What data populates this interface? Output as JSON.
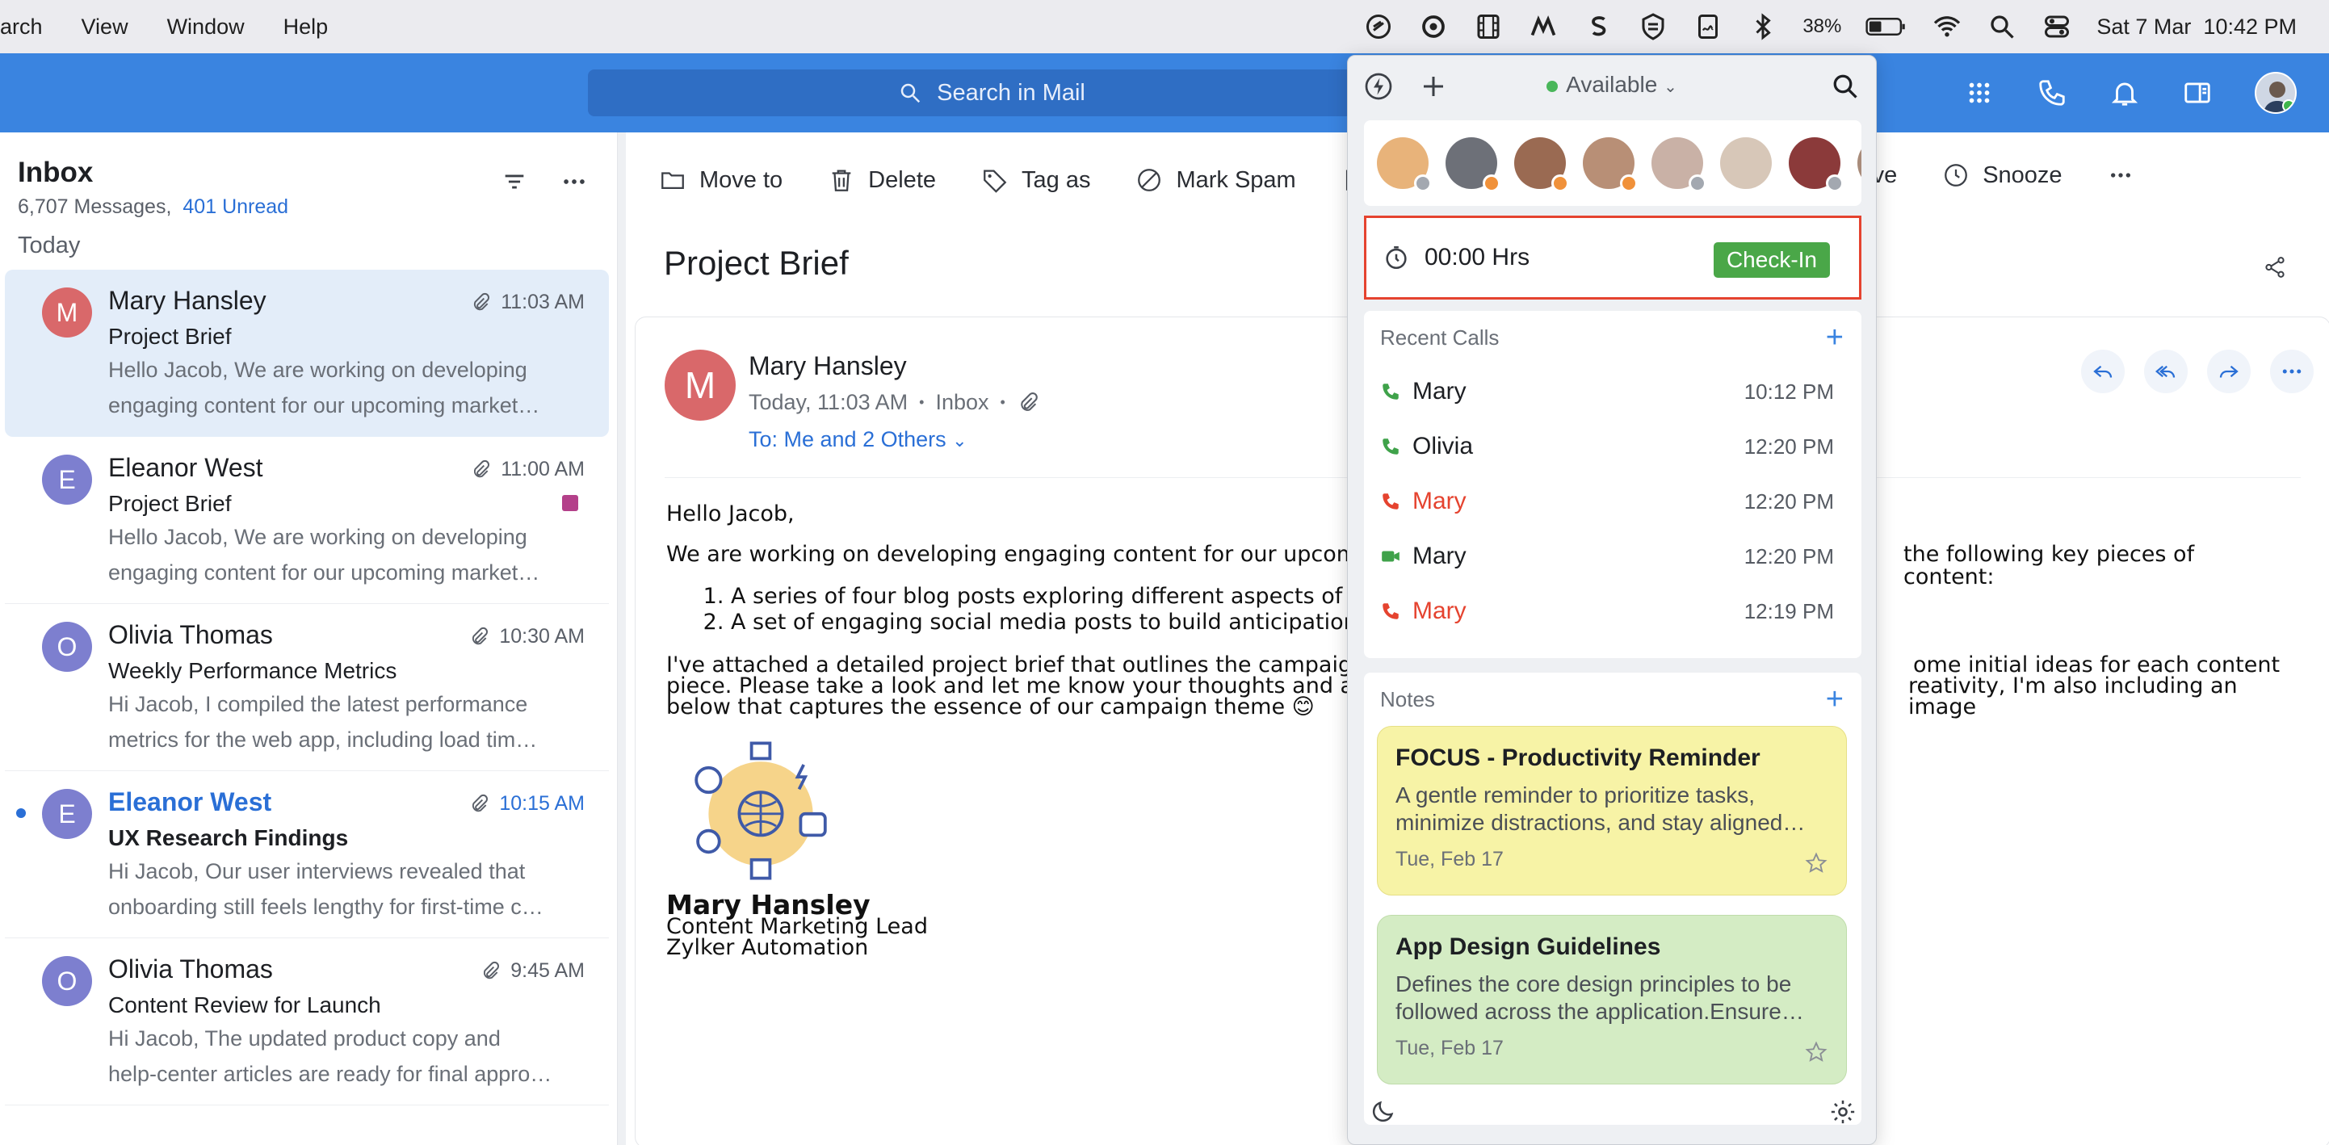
{
  "menubar": {
    "items": [
      "arch",
      "View",
      "Window",
      "Help"
    ],
    "battery": "38%",
    "datetime": "Sat 7 Mar  10:42 PM"
  },
  "header": {
    "search_placeholder": "Search in Mail"
  },
  "inbox": {
    "title": "Inbox",
    "message_count": "6,707 Messages,",
    "unread": "401 Unread",
    "group_label": "Today",
    "mails": [
      {
        "initial": "M",
        "sender": "Mary Hansley",
        "time": "11:03 AM",
        "subject": "Project Brief",
        "preview1": "Hello Jacob, We are working on developing",
        "preview2": "engaging content for our upcoming market…",
        "color": "#d9686a"
      },
      {
        "initial": "E",
        "sender": "Eleanor West",
        "time": "11:00 AM",
        "subject": "Project Brief",
        "preview1": "Hello Jacob, We are working on developing",
        "preview2": "engaging content for our upcoming market…",
        "color": "#7d7fcf"
      },
      {
        "initial": "O",
        "sender": "Olivia Thomas",
        "time": "10:30 AM",
        "subject": "Weekly Performance Metrics",
        "preview1": "Hi Jacob, I compiled the latest performance",
        "preview2": "metrics for the web app, including load tim…",
        "color": "#7d7fcf"
      },
      {
        "initial": "E",
        "sender": "Eleanor West",
        "time": "10:15 AM",
        "subject": "UX Research Findings",
        "preview1": "Hi Jacob, Our user interviews revealed that",
        "preview2": "onboarding still feels lengthy for first-time c…",
        "color": "#7d7fcf"
      },
      {
        "initial": "O",
        "sender": "Olivia Thomas",
        "time": "9:45 AM",
        "subject": "Content Review for Launch",
        "preview1": "Hi Jacob, The updated product copy and",
        "preview2": "help-center articles are ready for final appro…",
        "color": "#7d7fcf"
      }
    ]
  },
  "toolbar": {
    "move": "Move to",
    "delete": "Delete",
    "tag": "Tag as",
    "spam": "Mark Spam",
    "archive": "hive",
    "snooze": "Snooze"
  },
  "mail": {
    "subject": "Project Brief",
    "initial": "M",
    "sender": "Mary Hansley",
    "date": "Today, 11:03 AM",
    "folder": "Inbox",
    "to": "To: Me and 2 Others",
    "greeting": "Hello Jacob,",
    "para1": "We are working on developing engaging content for our upcom",
    "para1_end": "the following key pieces of content:",
    "item1": "A series of four blog posts exploring different aspects of",
    "item2": "A set of engaging social media posts to build anticipation",
    "para2_l1a": "I've attached a detailed project brief that outlines the campaig",
    "para2_l1b": "ome initial ideas for each content",
    "para2_l2a": "piece. Please take a look and let me know your thoughts and a",
    "para2_l2b": "reativity, I'm also including an image",
    "para2_l3": "below that captures the essence of our campaign theme 😊",
    "sig_name": "Mary Hansley",
    "sig_title": "Content Marketing Lead",
    "sig_company": "Zylker Automation"
  },
  "popup": {
    "status": "Available",
    "timer": "00:00 Hrs",
    "checkin": "Check-In",
    "recent_calls_label": "Recent Calls",
    "calls": [
      {
        "name": "Mary",
        "time": "10:12 PM",
        "type": "incoming"
      },
      {
        "name": "Olivia",
        "time": "12:20 PM",
        "type": "incoming"
      },
      {
        "name": "Mary",
        "time": "12:20 PM",
        "type": "missed"
      },
      {
        "name": "Mary",
        "time": "12:20 PM",
        "type": "video"
      },
      {
        "name": "Mary",
        "time": "12:19 PM",
        "type": "missed"
      }
    ],
    "notes_label": "Notes",
    "notes": [
      {
        "title": "FOCUS - Productivity Reminder",
        "body": "A gentle reminder to prioritize tasks, minimize distractions, and stay aligned…",
        "date": "Tue, Feb 17",
        "color": "#f7f3a6"
      },
      {
        "title": "App Design Guidelines",
        "body": "Defines the core design principles to be followed across the application.Ensure…",
        "date": "Tue, Feb 17",
        "color": "#d4ecc4"
      }
    ]
  }
}
